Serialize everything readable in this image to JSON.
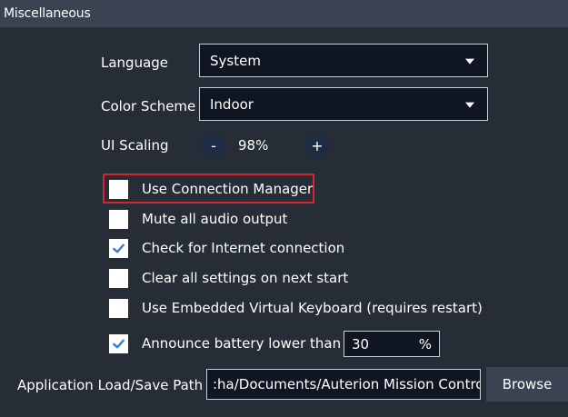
{
  "section": {
    "title": "Miscellaneous"
  },
  "language": {
    "label": "Language",
    "value": "System"
  },
  "color_scheme": {
    "label": "Color Scheme",
    "value": "Indoor"
  },
  "ui_scaling": {
    "label": "UI Scaling",
    "decrement": "-",
    "value": "98%",
    "increment": "+"
  },
  "options": [
    {
      "label": "Use Connection Manager",
      "checked": false,
      "highlighted": true
    },
    {
      "label": "Mute all audio output",
      "checked": false
    },
    {
      "label": "Check for Internet connection",
      "checked": true
    },
    {
      "label": "Clear all settings on next start",
      "checked": false
    },
    {
      "label": "Use Embedded Virtual Keyboard (requires restart)",
      "checked": false
    },
    {
      "label": "Announce battery lower than",
      "checked": true
    }
  ],
  "battery_threshold": {
    "value": "30",
    "unit": "%"
  },
  "load_save_path": {
    "label": "Application Load/Save Path",
    "value": ":ha/Documents/Auterion Mission Control",
    "browse_label": "Browse"
  },
  "colors": {
    "background": "#262d36",
    "header": "#3a4352",
    "field": "#0f1621",
    "highlight": "#d8242b",
    "check": "#2f7fd8"
  }
}
